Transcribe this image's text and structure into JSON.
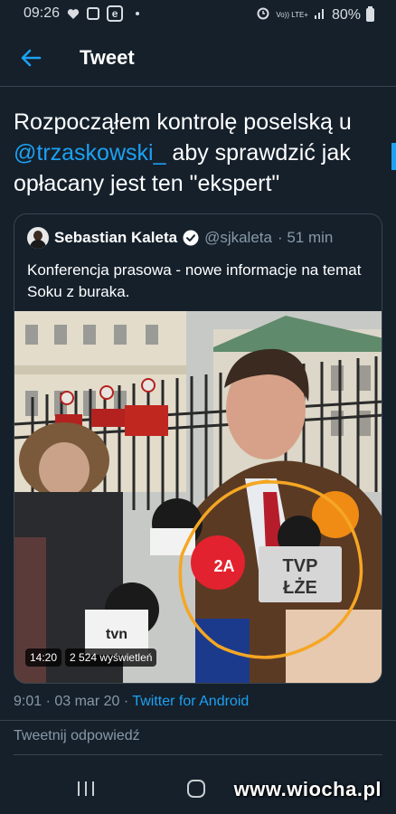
{
  "status_bar": {
    "time": "09:26",
    "network_label_top": "Vo)) LTE+",
    "network_label_bottom": "LTE",
    "battery": "80%"
  },
  "header": {
    "title": "Tweet",
    "back_icon": "arrow-left-icon"
  },
  "tweet": {
    "text_before": "Rozpocząłem kontrolę poselską u ",
    "mention": "@trzaskowski_",
    "text_after": " aby sprawdzić jak opłacany jest ten \"ekspert\"",
    "timestamp": "9:01 · 03 mar 20 · ",
    "source": "Twitter for Android"
  },
  "quoted_tweet": {
    "name": "Sebastian Kaleta",
    "handle": "@sjkaleta",
    "time": "· 51 min",
    "text": "Konferencja prasowa - nowe informacje na temat Soku z buraka.",
    "video_duration": "14:20",
    "views": "2 524 wyświetleń",
    "mic_labels": {
      "tvp_top": "TVP",
      "tvp_bottom": "ŁŻE",
      "tvn": "tvn",
      "channel_2a": "2A"
    }
  },
  "reply": {
    "placeholder": "Tweetnij odpowiedź"
  },
  "navbar": {
    "watermark": "www.wiocha.pl"
  },
  "colors": {
    "background": "#15202b",
    "accent": "#1da1f2",
    "muted": "#8899a6",
    "border": "#38444d",
    "annotation_circle": "#f5a623"
  }
}
